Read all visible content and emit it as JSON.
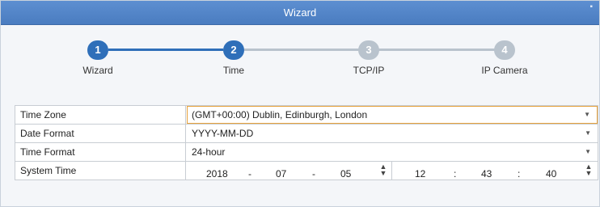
{
  "window": {
    "title": "Wizard",
    "close_icon": "close-icon"
  },
  "steps": [
    {
      "number": "1",
      "label": "Wizard",
      "state": "active"
    },
    {
      "number": "2",
      "label": "Time",
      "state": "active"
    },
    {
      "number": "3",
      "label": "TCP/IP",
      "state": "inactive"
    },
    {
      "number": "4",
      "label": "IP Camera",
      "state": "inactive"
    }
  ],
  "form": {
    "time_zone": {
      "label": "Time Zone",
      "value": "(GMT+00:00) Dublin, Edinburgh, London"
    },
    "date_format": {
      "label": "Date Format",
      "value": "YYYY-MM-DD"
    },
    "time_format": {
      "label": "Time Format",
      "value": "24-hour"
    },
    "system_time": {
      "label": "System Time",
      "date": {
        "year": "2018",
        "month": "07",
        "day": "05",
        "sep": "-"
      },
      "time": {
        "hour": "12",
        "minute": "43",
        "second": "40",
        "sep": ":"
      }
    }
  },
  "colors": {
    "accent": "#2f6fb9",
    "inactive": "#b9c3cd",
    "focus": "#e8a33d",
    "titlebar": "#4a7cc0"
  }
}
